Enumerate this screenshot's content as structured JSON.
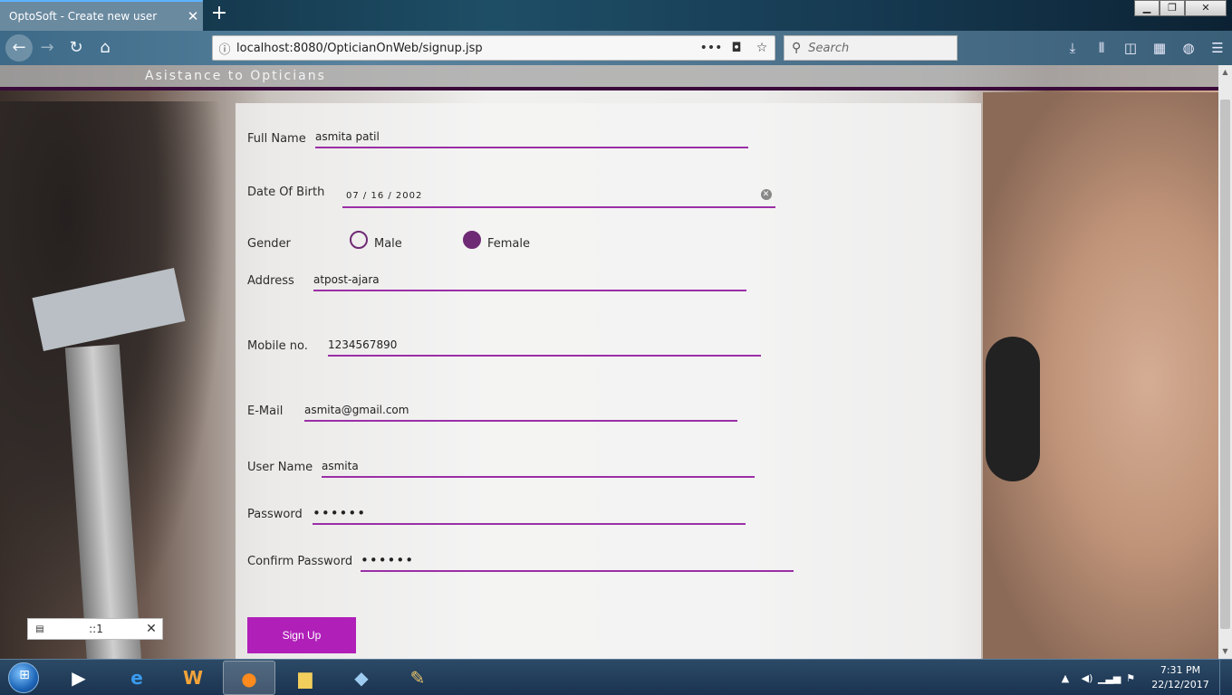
{
  "browser": {
    "tab_title": "OptoSoft - Create new user",
    "tab_close": "✕",
    "new_tab": "+",
    "url": "localhost:8080/OpticianOnWeb/signup.jsp",
    "search_placeholder": "Search",
    "window_controls": {
      "minimize": "▁",
      "restore": "❐",
      "close": "✕"
    }
  },
  "site": {
    "tagline": "Asistance to Opticians"
  },
  "form": {
    "full_name": {
      "label": "Full Name",
      "value": "asmita patil"
    },
    "dob": {
      "label": "Date Of Birth",
      "value": "07 / 16 / 2002"
    },
    "gender": {
      "label": "Gender",
      "options": [
        "Male",
        "Female"
      ],
      "selected": "Female"
    },
    "address": {
      "label": "Address",
      "value": "atpost-ajara"
    },
    "mobile": {
      "label": "Mobile no.",
      "value": "1234567890"
    },
    "email": {
      "label": "E-Mail",
      "value": "asmita@gmail.com"
    },
    "username": {
      "label": "User Name",
      "value": "asmita"
    },
    "password": {
      "label": "Password",
      "value": "••••••"
    },
    "confirm_password": {
      "label": "Confirm Password",
      "value": "••••••"
    },
    "submit_label": "Sign Up"
  },
  "download_box": {
    "text": "::1",
    "close": "✕"
  },
  "taskbar": {
    "time": "7:31 PM",
    "date": "22/12/2017"
  },
  "colors": {
    "accent": "#9b2ea6",
    "button": "#b01fb8",
    "radio": "#6e2a74"
  }
}
